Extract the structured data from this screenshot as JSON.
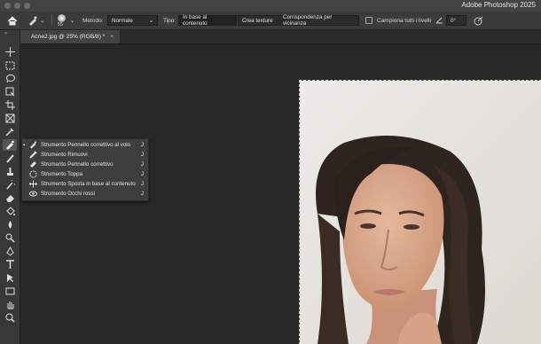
{
  "app_title": "Adobe Photoshop 2025",
  "options": {
    "brush_size": "55",
    "metodo_label": "Metodo:",
    "metodo_value": "Normale",
    "tipo_label": "Tipo:",
    "tipo_options": [
      "In base al contenuto",
      "Crea texture",
      "Corrispondenza per vicinanza"
    ],
    "tipo_selected": "In base al contenuto",
    "sample_all_label": "Campiona tutti i livelli",
    "angle_value": "0°"
  },
  "document_tab": {
    "label": "Acne2.jpg @ 25% (RGB/8) *"
  },
  "toolbar": {
    "tools": [
      "move-tool-icon",
      "marquee-tool-icon",
      "lasso-tool-icon",
      "object-select-icon",
      "crop-tool-icon",
      "frame-tool-icon",
      "eyedropper-icon",
      "spot-healing-brush-icon",
      "brush-tool-icon",
      "clone-stamp-icon",
      "history-brush-icon",
      "eraser-icon",
      "paint-bucket-icon",
      "blur-tool-icon",
      "dodge-tool-icon",
      "pen-tool-icon",
      "type-tool-icon",
      "path-select-icon",
      "rectangle-tool-icon",
      "hand-tool-icon",
      "zoom-tool-icon"
    ]
  },
  "flyout": {
    "items": [
      {
        "label": "Strumento Pennello correttivo al volo",
        "key": "J",
        "icon": "spot-healing-brush-icon",
        "current": true
      },
      {
        "label": "Strumento Rimuovi",
        "key": "J",
        "icon": "remove-tool-icon",
        "current": false
      },
      {
        "label": "Strumento Pennello correttivo",
        "key": "J",
        "icon": "healing-brush-icon",
        "current": false
      },
      {
        "label": "Strumento Toppa",
        "key": "J",
        "icon": "patch-tool-icon",
        "current": false
      },
      {
        "label": "Strumento Sposta in base al contenuto",
        "key": "J",
        "icon": "content-aware-move-icon",
        "current": false
      },
      {
        "label": "Strumento Occhi rossi",
        "key": "J",
        "icon": "red-eye-icon",
        "current": false
      }
    ]
  },
  "colors": {
    "panel_bg": "#383838",
    "canvas_bg": "#282828",
    "photo_bg": "#e6e3de"
  }
}
